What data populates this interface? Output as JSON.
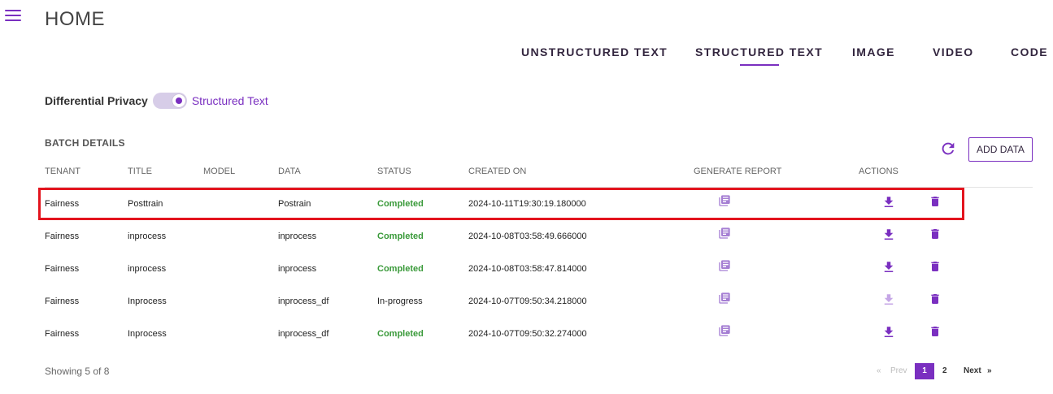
{
  "header": {
    "title": "HOME",
    "menu_icon": "hamburger-menu-icon"
  },
  "tabs": [
    {
      "label": "UNSTRUCTURED TEXT",
      "active": false
    },
    {
      "label": "STRUCTURED TEXT",
      "active": true
    },
    {
      "label": "IMAGE",
      "active": false
    },
    {
      "label": "VIDEO",
      "active": false
    },
    {
      "label": "CODE",
      "active": false
    }
  ],
  "privacy": {
    "label": "Differential Privacy",
    "toggle_on": true,
    "value": "Structured Text"
  },
  "batch": {
    "title": "BATCH DETAILS",
    "refresh_icon": "refresh-icon",
    "add_data_label": "ADD DATA",
    "columns": [
      "TENANT",
      "TITLE",
      "MODEL",
      "DATA",
      "STATUS",
      "CREATED ON",
      "GENERATE REPORT",
      "ACTIONS"
    ],
    "rows": [
      {
        "tenant": "Fairness",
        "title": "Posttrain",
        "model": "",
        "data": "Postrain",
        "status": "Completed",
        "created_on": "2024-10-11T19:30:19.180000",
        "download_enabled": true,
        "highlighted": true
      },
      {
        "tenant": "Fairness",
        "title": "inprocess",
        "model": "",
        "data": "inprocess",
        "status": "Completed",
        "created_on": "2024-10-08T03:58:49.666000",
        "download_enabled": true
      },
      {
        "tenant": "Fairness",
        "title": "inprocess",
        "model": "",
        "data": "inprocess",
        "status": "Completed",
        "created_on": "2024-10-08T03:58:47.814000",
        "download_enabled": true
      },
      {
        "tenant": "Fairness",
        "title": "Inprocess",
        "model": "",
        "data": "inprocess_df",
        "status": "In-progress",
        "created_on": "2024-10-07T09:50:34.218000",
        "download_enabled": false
      },
      {
        "tenant": "Fairness",
        "title": "Inprocess",
        "model": "",
        "data": "inprocess_df",
        "status": "Completed",
        "created_on": "2024-10-07T09:50:32.274000",
        "download_enabled": true
      }
    ]
  },
  "footer": {
    "showing": "Showing 5 of 8",
    "pager": {
      "prev_arrow": "«",
      "prev": "Prev",
      "pages": [
        "1",
        "2"
      ],
      "active_page": "1",
      "next": "Next",
      "next_arrow": "»"
    }
  },
  "colors": {
    "accent": "#7a2fc0",
    "completed": "#3a9a3a",
    "highlight": "#e3141e"
  }
}
